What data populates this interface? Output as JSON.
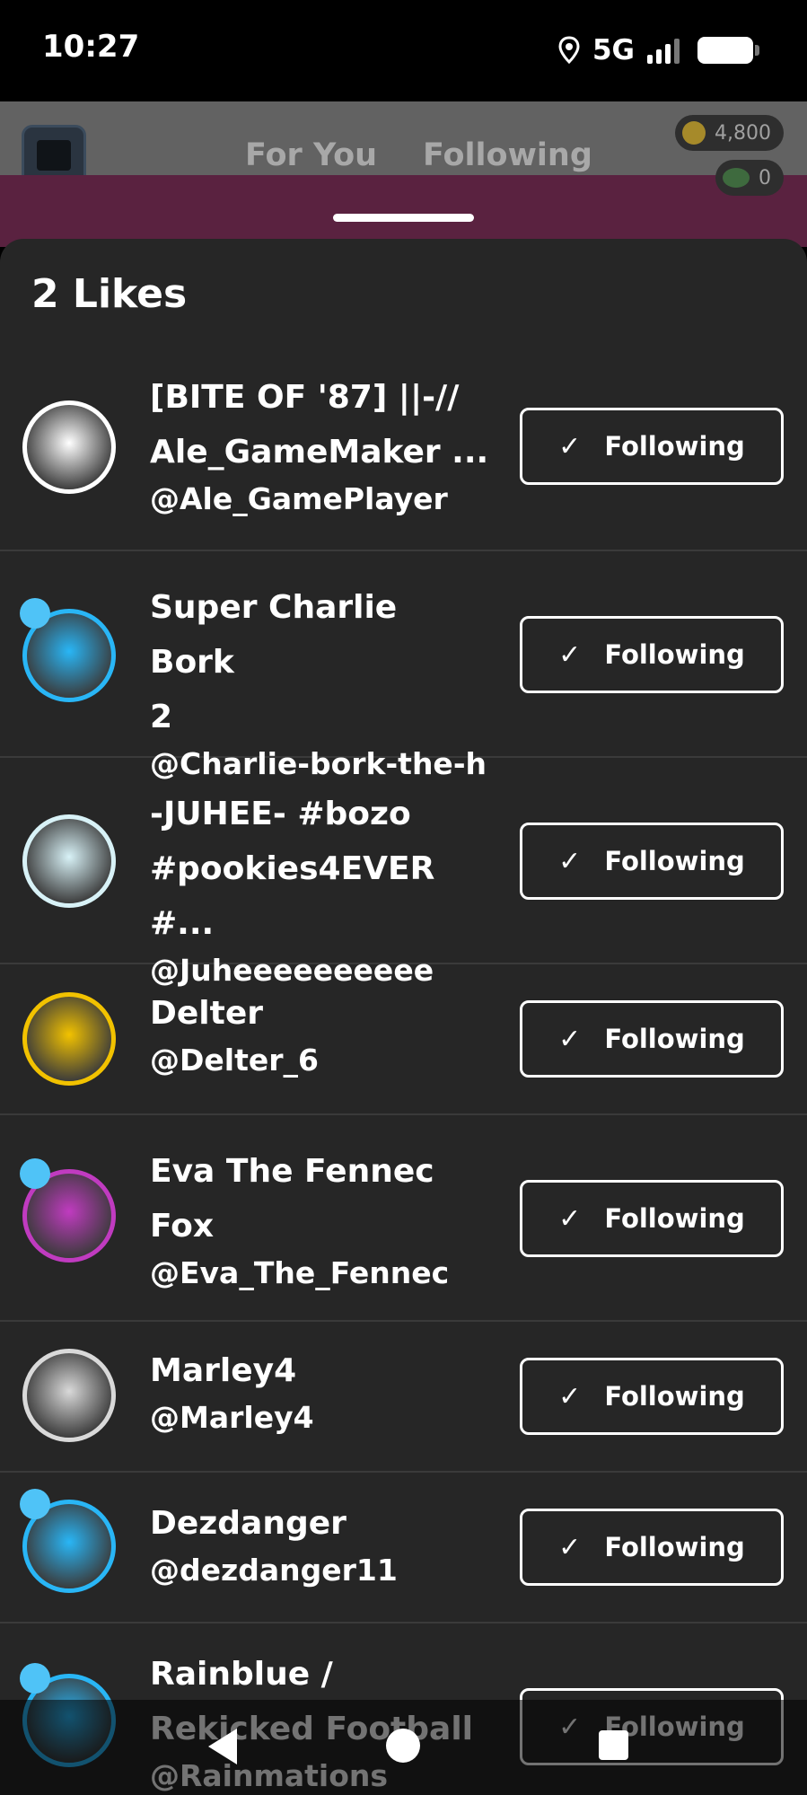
{
  "status_bar": {
    "time": "10:27",
    "network": "5G"
  },
  "header": {
    "tabs": [
      "For You",
      "Following"
    ],
    "coins": "4,800",
    "gems": "0"
  },
  "sheet": {
    "title": "2 Likes",
    "follow_label": "Following",
    "users": [
      {
        "display_name": "[BITE OF '87] ||-//\nAle_GameMaker ...",
        "username": "@Ale_GamePlayer",
        "avatar_icon": "spiral-character-avatar",
        "accent": "#ffffff"
      },
      {
        "display_name": "Super Charlie Bork\n2",
        "username": "@Charlie-bork-the-h",
        "avatar_icon": "fire-dog-avatar",
        "accent": "#29b6f6"
      },
      {
        "display_name": "-JUHEE- #bozo\n#pookies4EVER #...",
        "username": "@Juheeeeeeeeee",
        "avatar_icon": "pink-bunny-avatar",
        "accent": "#d8f2f7"
      },
      {
        "display_name": "Delter",
        "username": "@Delter_6",
        "avatar_icon": "moon-diamond-avatar",
        "accent": "#f2c200"
      },
      {
        "display_name": "Eva The Fennec\nFox",
        "username": "@Eva_The_Fennec",
        "avatar_icon": "fennec-fox-avatar",
        "accent": "#c03bc0"
      },
      {
        "display_name": "Marley4",
        "username": "@Marley4",
        "avatar_icon": "box-face-avatar",
        "accent": "#d9d9d9"
      },
      {
        "display_name": "Dezdanger",
        "username": "@dezdanger11",
        "avatar_icon": "robot-bunny-avatar",
        "accent": "#29b6f6"
      },
      {
        "display_name": "Rainblue /\nRekicked Football",
        "username": "@Rainmations",
        "avatar_icon": "blue-character-avatar",
        "accent": "#29b6f6"
      }
    ]
  }
}
